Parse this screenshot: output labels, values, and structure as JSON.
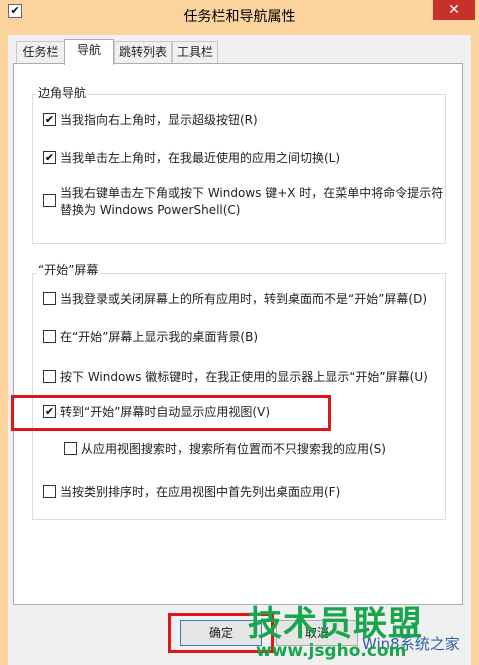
{
  "window": {
    "title": "任务栏和导航属性",
    "close_glyph": "✕",
    "icon": "taskbar-properties-icon",
    "title_bar_color": "#fbd39c"
  },
  "tabs": [
    {
      "label": "任务栏",
      "active": false
    },
    {
      "label": "导航",
      "active": true
    },
    {
      "label": "跳转列表",
      "active": false
    },
    {
      "label": "工具栏",
      "active": false
    }
  ],
  "corner_nav": {
    "title": "边角导航",
    "options": [
      {
        "label": "当我指向右上角时，显示超级按钮(R)",
        "checked": true
      },
      {
        "label": "当我单击左上角时，在我最近使用的应用之间切换(L)",
        "checked": true
      },
      {
        "label_line1": "当我右键单击左下角或按下 Windows 键+X 时，在菜单中将命令提示符",
        "label_line2": "替换为 Windows PowerShell(C)",
        "checked": false
      }
    ]
  },
  "start_screen": {
    "title": "“开始”屏幕",
    "options": [
      {
        "label": "当我登录或关闭屏幕上的所有应用时，转到桌面而不是“开始”屏幕(D)",
        "checked": false
      },
      {
        "label": "在“开始”屏幕上显示我的桌面背景(B)",
        "checked": false
      },
      {
        "label": "按下 Windows 徽标键时，在我正使用的显示器上显示“开始”屏幕(U)",
        "checked": false
      },
      {
        "label": "转到“开始”屏幕时自动显示应用视图(V)",
        "checked": true
      },
      {
        "label": "从应用视图搜索时，搜索所有位置而不只搜索我的应用(S)",
        "checked": false
      },
      {
        "label": "当按类别排序时，在应用视图中首先列出桌面应用(F)",
        "checked": false
      }
    ]
  },
  "buttons": {
    "ok": "确定",
    "cancel": "取消"
  },
  "watermark": {
    "brand": "技术员联盟",
    "url": "www.jsgho.com",
    "small": "Win8系统之家"
  },
  "highlight_color": "#e0161b",
  "checkmark": "✔"
}
